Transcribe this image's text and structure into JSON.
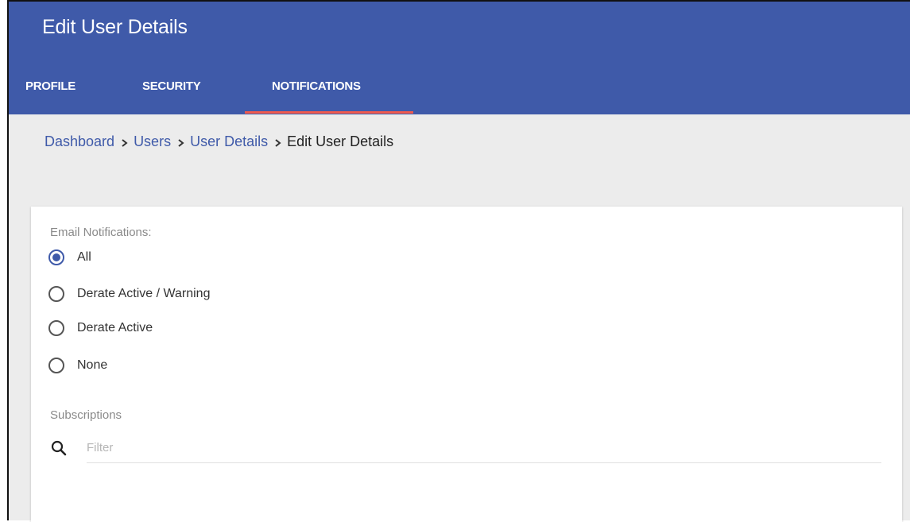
{
  "header": {
    "title": "Edit User Details",
    "accent_color": "#3f5aa9",
    "tab_indicator_color": "#f05a4e",
    "tabs": [
      {
        "label": "PROFILE",
        "active": false
      },
      {
        "label": "SECURITY",
        "active": false
      },
      {
        "label": "NOTIFICATIONS",
        "active": true
      }
    ]
  },
  "breadcrumb": {
    "items": [
      {
        "label": "Dashboard",
        "link": true
      },
      {
        "label": "Users",
        "link": true
      },
      {
        "label": "User Details",
        "link": true
      },
      {
        "label": "Edit User Details",
        "link": false
      }
    ],
    "separator_icon": "chevron-right-icon"
  },
  "email_notifications": {
    "label": "Email Notifications:",
    "selected": "All",
    "options": [
      "All",
      "Derate Active / Warning",
      "Derate Active",
      "None"
    ]
  },
  "subscriptions": {
    "label": "Subscriptions",
    "filter_placeholder": "Filter",
    "filter_value": "",
    "icon": "search-icon"
  }
}
